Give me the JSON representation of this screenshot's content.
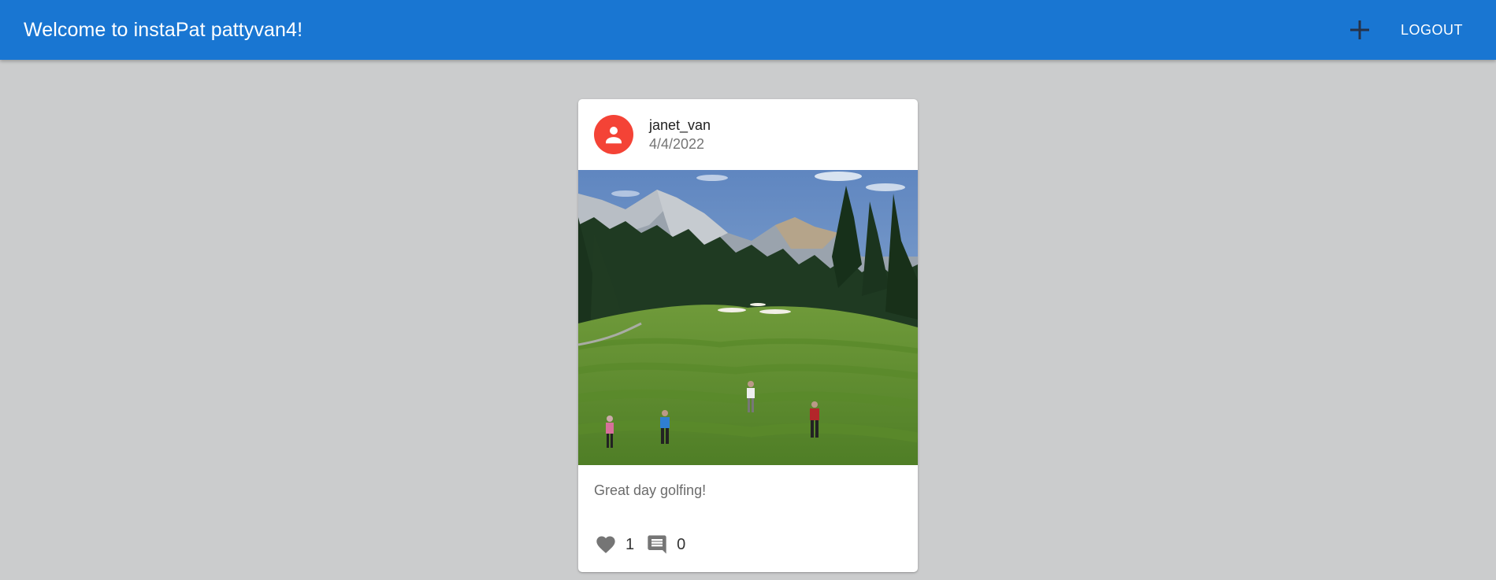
{
  "header": {
    "title": "Welcome to instaPat pattyvan4!",
    "logout_label": "LOGOUT",
    "add_icon": "plus-icon",
    "background": "#1976d2"
  },
  "post": {
    "username": "janet_van",
    "date": "4/4/2022",
    "avatar_icon": "person-icon",
    "avatar_color": "#f44336",
    "caption": "Great day golfing!",
    "likes": "1",
    "comments": "0",
    "like_icon": "heart-icon",
    "comment_icon": "comment-icon"
  }
}
